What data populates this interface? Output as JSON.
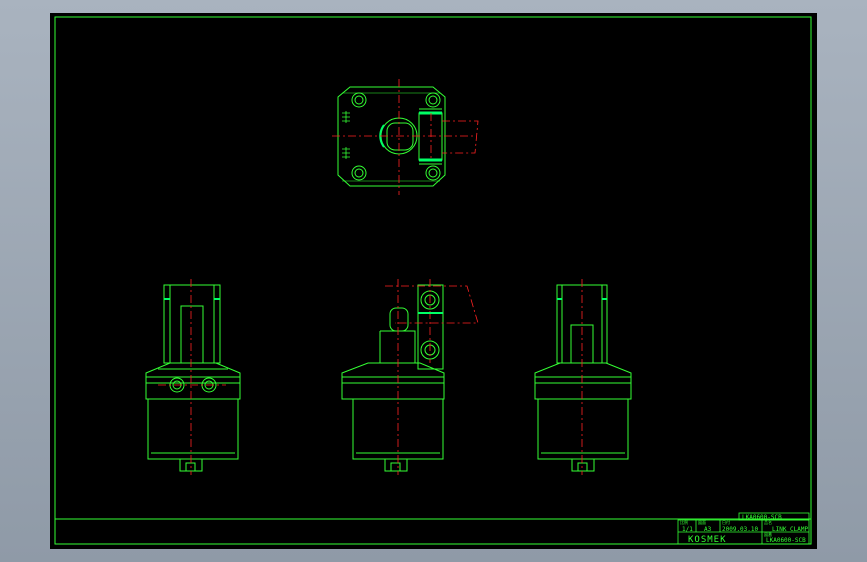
{
  "colors": {
    "background": "#000000",
    "outline": "#33ff33",
    "centerline": "#ff2222",
    "frame_bg": "#a3adb9"
  },
  "title_block": {
    "part_code": "LKA0600-SCB",
    "scale_label": "比例",
    "scale": "1/1",
    "sheet_label": "図面",
    "sheet": "A3",
    "date_label": "日付",
    "date": "2009.03.10",
    "name_label": "品名",
    "name": "LINK CLAMP",
    "drawing_no_label": "図番",
    "drawing_no": "LKA0600-SCB",
    "logo": "KOSMEK"
  }
}
